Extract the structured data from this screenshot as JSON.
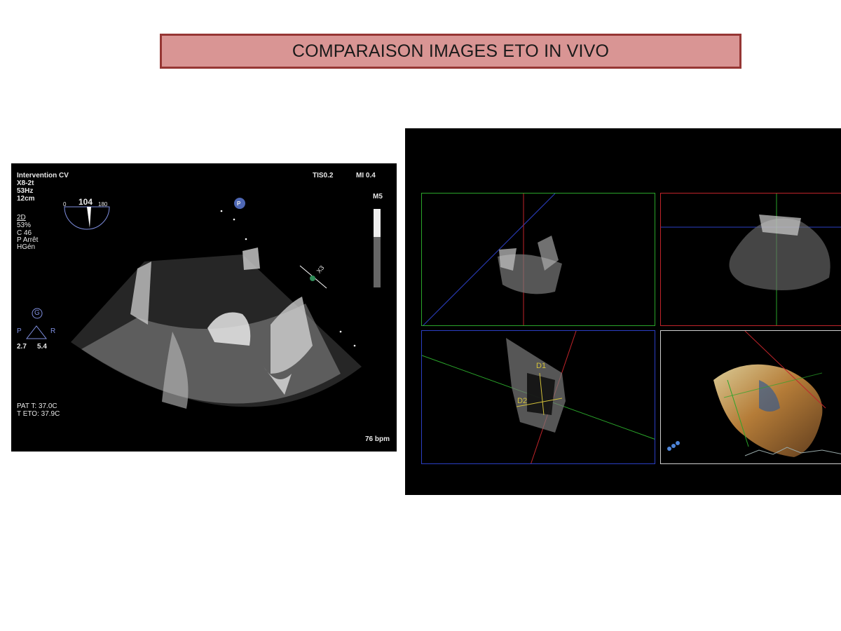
{
  "slide": {
    "title": "COMPARAISON IMAGES  ETO IN VIVO"
  },
  "left_echo": {
    "header_left": [
      "Intervention CV",
      "X8-2t",
      "53Hz",
      "12cm"
    ],
    "settings": [
      "2D",
      " 53%",
      "C 46",
      "P Arrêt",
      " HGén"
    ],
    "tis": "TIS0.2",
    "mi": "MI 0.4",
    "scale_label": "M5",
    "angle_min": "0",
    "angle_value": "104",
    "angle_max": "180",
    "p_marker": "P",
    "zoom_label": "X3",
    "orientation": {
      "g": "G",
      "p": "P",
      "r": "R",
      "val_left": "2.7",
      "val_right": "5.4"
    },
    "temps": [
      "PAT T: 37.0C",
      "T ETO: 37.9C"
    ],
    "heart_rate": "76 bpm"
  },
  "right_echo": {
    "measure_d1": "D1",
    "measure_d2": "D2",
    "colors": {
      "green": "#2aa52a",
      "red": "#c0242a",
      "blue": "#2b3fc4",
      "white": "#cfcfcf",
      "yellow": "#d4c23a"
    }
  }
}
